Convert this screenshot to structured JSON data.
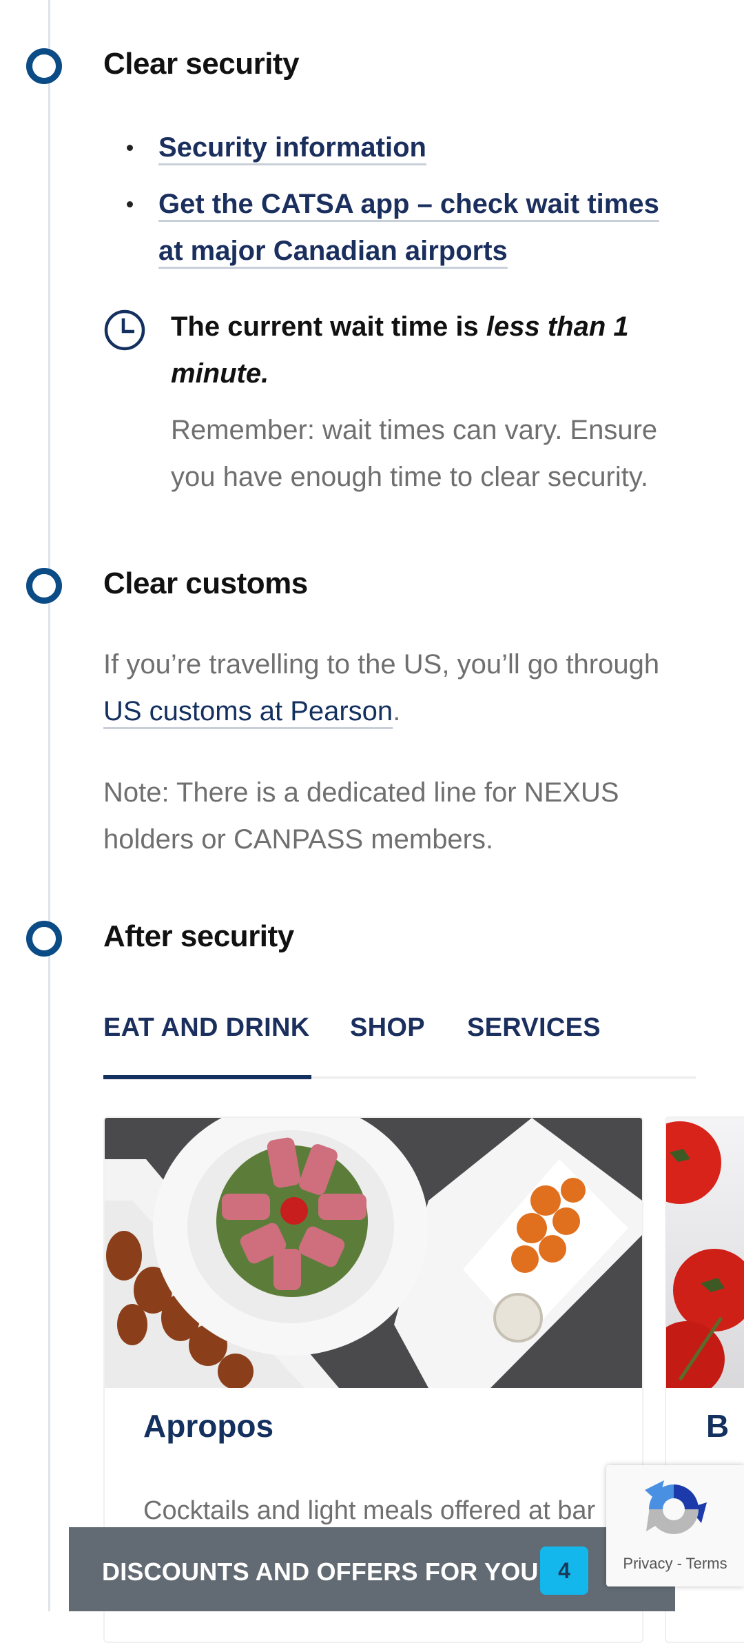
{
  "colors": {
    "accent_navy": "#13305f",
    "link": "#1b2f5e",
    "timeline_dot": "#0b4b86",
    "muted_text": "#6f6f6f",
    "offers_bar": "#626b73",
    "offers_badge": "#13b7ec"
  },
  "steps": {
    "security": {
      "title": "Clear security",
      "links": [
        "Security information",
        "Get the CATSA app – check wait times at major Canadian airports"
      ],
      "wait_time": {
        "icon": "clock-icon",
        "prefix": "The current wait time is ",
        "value": "less than 1 minute.",
        "note": "Remember: wait times can vary. Ensure you have enough time to clear security."
      }
    },
    "customs": {
      "title": "Clear customs",
      "text_prefix": "If you’re travelling to the US, you’ll go through ",
      "link": "US customs at Pearson",
      "text_suffix": ".",
      "note": "Note: There is a dedicated line for NEXUS holders or CANPASS members."
    },
    "after_security": {
      "title": "After security",
      "tabs": [
        {
          "label": "EAT AND DRINK",
          "active": true
        },
        {
          "label": "SHOP",
          "active": false
        },
        {
          "label": "SERVICES",
          "active": false
        }
      ],
      "cards": [
        {
          "title": "Apropos",
          "description": "Cocktails and light meals offered at bar",
          "image": "food-platters-photo"
        },
        {
          "title": "B",
          "image": "tomatoes-photo"
        }
      ]
    }
  },
  "offers_bar": {
    "label": "DISCOUNTS AND OFFERS FOR YOU",
    "count": "4"
  },
  "recaptcha": {
    "links": "Privacy - Terms"
  }
}
